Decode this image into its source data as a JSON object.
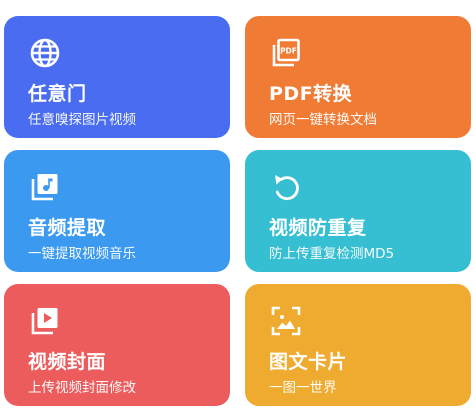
{
  "cards": [
    {
      "title": "任意门",
      "subtitle": "任意嗅探图片视频",
      "icon": "globe-icon",
      "color": "#4a6cf0"
    },
    {
      "title": "PDF转换",
      "subtitle": "网页一键转换文档",
      "icon": "pdf-file-icon",
      "color": "#f07b35"
    },
    {
      "title": "音频提取",
      "subtitle": "一键提取视频音乐",
      "icon": "music-album-icon",
      "color": "#3b9af0"
    },
    {
      "title": "视频防重复",
      "subtitle": "防上传重复检测MD5",
      "icon": "rotate-back-icon",
      "color": "#36bfd3"
    },
    {
      "title": "视频封面",
      "subtitle": "上传视频封面修改",
      "icon": "video-play-icon",
      "color": "#ec5c5c"
    },
    {
      "title": "图文卡片",
      "subtitle": "一图一世界",
      "icon": "image-frame-icon",
      "color": "#eeab2f"
    }
  ]
}
